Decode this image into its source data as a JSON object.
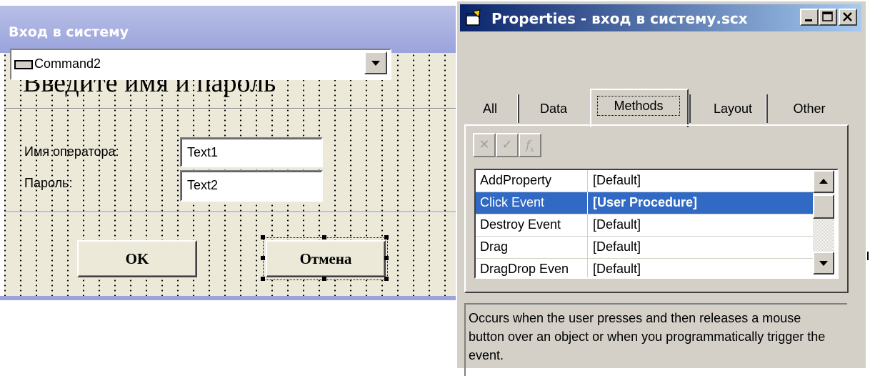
{
  "form": {
    "title": "Вход в систему",
    "heading": "Введите имя и пароль",
    "operator_label": "Имя оператора:",
    "operator_value": "Text1",
    "password_label": "Пароль:",
    "password_value": "Text2",
    "ok_label": "OK",
    "cancel_label": "Отмена"
  },
  "properties": {
    "title": "Properties - вход в систему.scx",
    "object": "Command2",
    "tabs": [
      "All",
      "Data",
      "Methods",
      "Layout",
      "Other"
    ],
    "active_tab": "Methods",
    "toolbar_icons": [
      "cancel-icon",
      "accept-icon",
      "function-icon"
    ],
    "rows": [
      {
        "name": "AddProperty",
        "value": "[Default]"
      },
      {
        "name": "Click Event",
        "value": "[User Procedure]"
      },
      {
        "name": "Destroy Event",
        "value": "[Default]"
      },
      {
        "name": "Drag",
        "value": "[Default]"
      },
      {
        "name": "DragDrop Even",
        "value": "[Default]"
      }
    ],
    "selected_row": "Click Event",
    "description": "Occurs when the user presses and then releases a mouse button over an object or when you programmatically trigger the event."
  },
  "colors": {
    "form_title_bar": "#9aa3dc",
    "props_title_bar": "#0a246a",
    "selection": "#316ac5",
    "face": "#d4d0c8"
  }
}
